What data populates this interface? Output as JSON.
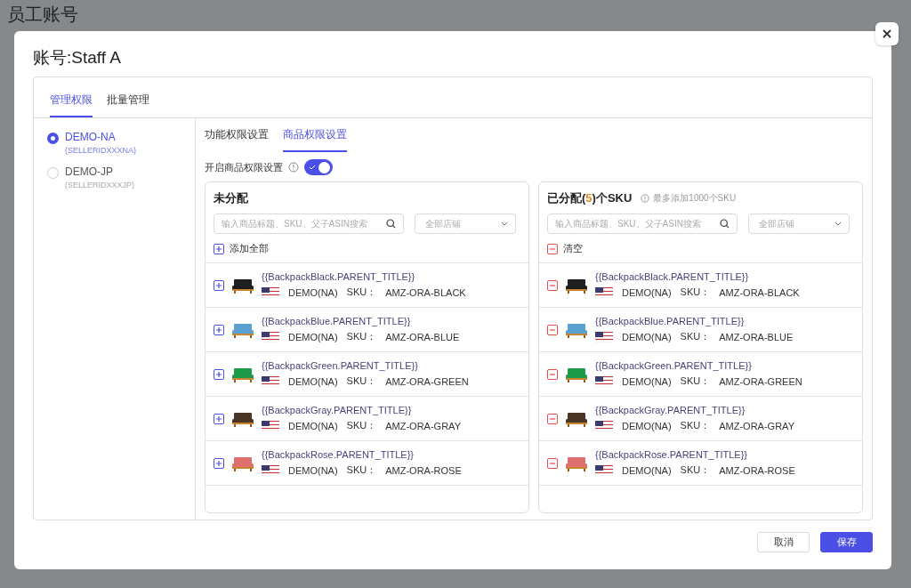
{
  "page_title": "员工账号",
  "dialog": {
    "title": "账号:Staff A",
    "tabs": [
      {
        "label": "管理权限",
        "selected": true
      },
      {
        "label": "批量管理",
        "selected": false
      }
    ],
    "accounts": [
      {
        "name": "DEMO-NA",
        "id": "(SELLERIDXXXNA)",
        "selected": true
      },
      {
        "name": "DEMO-JP",
        "id": "(SELLERIDXXXJP)",
        "selected": false
      }
    ],
    "sub_tabs": [
      {
        "label": "功能权限设置",
        "selected": false
      },
      {
        "label": "商品权限设置",
        "selected": true
      }
    ],
    "toggle": {
      "label": "开启商品权限设置",
      "on": true
    },
    "panels": [
      {
        "kind": "add",
        "title": "未分配",
        "search_placeholder": "输入商品标题、SKU、父子ASIN搜索",
        "store_select": "全部店铺",
        "action": "添加全部",
        "items": [
          {
            "title": "{{BackpackBlack.PARENT_TITLE}}",
            "store": "DEMO(NA)",
            "sku_label": "SKU：",
            "sku": "AMZ-ORA-BLACK",
            "color": "#1e1e1e"
          },
          {
            "title": "{{BackpackBlue.PARENT_TITLE}}",
            "store": "DEMO(NA)",
            "sku_label": "SKU：",
            "sku": "AMZ-ORA-BLUE",
            "color": "#5aa0d0"
          },
          {
            "title": "{{BackpackGreen.PARENT_TITLE}}",
            "store": "DEMO(NA)",
            "sku_label": "SKU：",
            "sku": "AMZ-ORA-GREEN",
            "color": "#1f9a4a"
          },
          {
            "title": "{{BackpackGray.PARENT_TITLE}}",
            "store": "DEMO(NA)",
            "sku_label": "SKU：",
            "sku": "AMZ-ORA-GRAY",
            "color": "#4a3426"
          },
          {
            "title": "{{BackpackRose.PARENT_TITLE}}",
            "store": "DEMO(NA)",
            "sku_label": "SKU：",
            "sku": "AMZ-ORA-ROSE",
            "color": "#e07070"
          }
        ]
      },
      {
        "kind": "remove",
        "title_prefix": "已分配(",
        "count": "5",
        "title_suffix": ")个SKU",
        "note": "最多添加1000个SKU",
        "search_placeholder": "输入商品标题、SKU、父子ASIN搜索",
        "store_select": "全部店铺",
        "action": "清空",
        "items": [
          {
            "title": "{{BackpackBlack.PARENT_TITLE}}",
            "store": "DEMO(NA)",
            "sku_label": "SKU：",
            "sku": "AMZ-ORA-BLACK",
            "color": "#1e1e1e"
          },
          {
            "title": "{{BackpackBlue.PARENT_TITLE}}",
            "store": "DEMO(NA)",
            "sku_label": "SKU：",
            "sku": "AMZ-ORA-BLUE",
            "color": "#5aa0d0"
          },
          {
            "title": "{{BackpackGreen.PARENT_TITLE}}",
            "store": "DEMO(NA)",
            "sku_label": "SKU：",
            "sku": "AMZ-ORA-GREEN",
            "color": "#1f9a4a"
          },
          {
            "title": "{{BackpackGray.PARENT_TITLE}}",
            "store": "DEMO(NA)",
            "sku_label": "SKU：",
            "sku": "AMZ-ORA-GRAY",
            "color": "#4a3426"
          },
          {
            "title": "{{BackpackRose.PARENT_TITLE}}",
            "store": "DEMO(NA)",
            "sku_label": "SKU：",
            "sku": "AMZ-ORA-ROSE",
            "color": "#e07070"
          }
        ]
      }
    ],
    "buttons": [
      {
        "label": "取消",
        "kind": "secondary"
      },
      {
        "label": "保存",
        "kind": "primary"
      }
    ]
  }
}
